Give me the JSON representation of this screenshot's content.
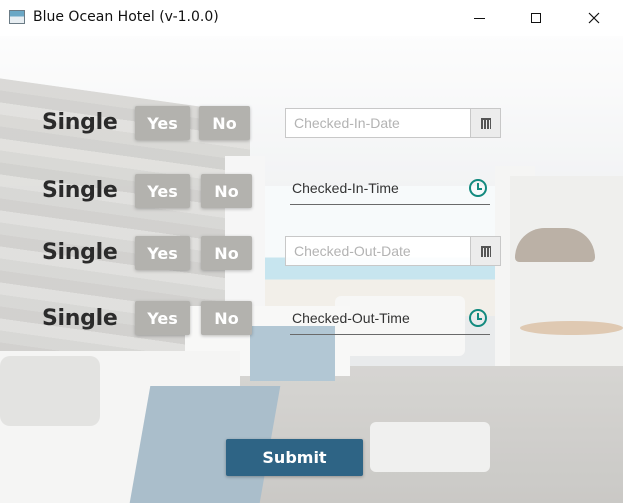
{
  "window": {
    "title": "Blue Ocean Hotel (v-1.0.0)",
    "controls": {
      "minimize": "minimize-icon",
      "maximize": "maximize-icon",
      "close": "close-icon"
    }
  },
  "rows": [
    {
      "label": "Single",
      "yes": "Yes",
      "no": "No"
    },
    {
      "label": "Single",
      "yes": "Yes",
      "no": "No"
    },
    {
      "label": "Single",
      "yes": "Yes",
      "no": "No"
    },
    {
      "label": "Single",
      "yes": "Yes",
      "no": "No"
    }
  ],
  "fields": {
    "checked_in_date": {
      "placeholder": "Checked-In-Date",
      "icon": "calendar-icon"
    },
    "checked_in_time": {
      "value": "Checked-In-Time",
      "icon": "clock-icon"
    },
    "checked_out_date": {
      "placeholder": "Checked-Out-Date",
      "icon": "calendar-icon"
    },
    "checked_out_time": {
      "value": "Checked-Out-Time",
      "icon": "clock-icon"
    }
  },
  "submit_label": "Submit",
  "colors": {
    "toggle_button": "#b3b2ae",
    "submit_button": "#2e6485",
    "clock_accent": "#138a7f",
    "label_text": "#2b2b2b"
  }
}
